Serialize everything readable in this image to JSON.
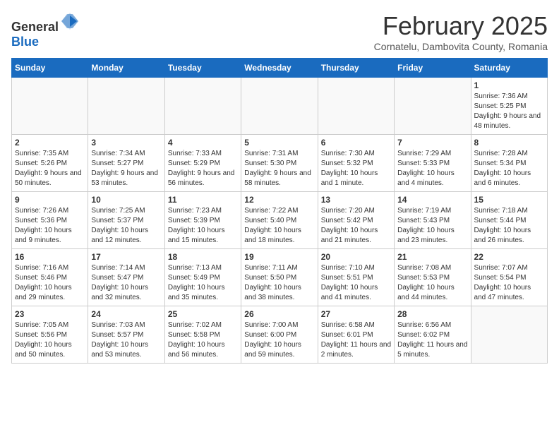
{
  "header": {
    "logo_general": "General",
    "logo_blue": "Blue",
    "month": "February 2025",
    "location": "Cornatelu, Dambovita County, Romania"
  },
  "weekdays": [
    "Sunday",
    "Monday",
    "Tuesday",
    "Wednesday",
    "Thursday",
    "Friday",
    "Saturday"
  ],
  "weeks": [
    [
      {
        "day": "",
        "info": ""
      },
      {
        "day": "",
        "info": ""
      },
      {
        "day": "",
        "info": ""
      },
      {
        "day": "",
        "info": ""
      },
      {
        "day": "",
        "info": ""
      },
      {
        "day": "",
        "info": ""
      },
      {
        "day": "1",
        "info": "Sunrise: 7:36 AM\nSunset: 5:25 PM\nDaylight: 9 hours and 48 minutes."
      }
    ],
    [
      {
        "day": "2",
        "info": "Sunrise: 7:35 AM\nSunset: 5:26 PM\nDaylight: 9 hours and 50 minutes."
      },
      {
        "day": "3",
        "info": "Sunrise: 7:34 AM\nSunset: 5:27 PM\nDaylight: 9 hours and 53 minutes."
      },
      {
        "day": "4",
        "info": "Sunrise: 7:33 AM\nSunset: 5:29 PM\nDaylight: 9 hours and 56 minutes."
      },
      {
        "day": "5",
        "info": "Sunrise: 7:31 AM\nSunset: 5:30 PM\nDaylight: 9 hours and 58 minutes."
      },
      {
        "day": "6",
        "info": "Sunrise: 7:30 AM\nSunset: 5:32 PM\nDaylight: 10 hours and 1 minute."
      },
      {
        "day": "7",
        "info": "Sunrise: 7:29 AM\nSunset: 5:33 PM\nDaylight: 10 hours and 4 minutes."
      },
      {
        "day": "8",
        "info": "Sunrise: 7:28 AM\nSunset: 5:34 PM\nDaylight: 10 hours and 6 minutes."
      }
    ],
    [
      {
        "day": "9",
        "info": "Sunrise: 7:26 AM\nSunset: 5:36 PM\nDaylight: 10 hours and 9 minutes."
      },
      {
        "day": "10",
        "info": "Sunrise: 7:25 AM\nSunset: 5:37 PM\nDaylight: 10 hours and 12 minutes."
      },
      {
        "day": "11",
        "info": "Sunrise: 7:23 AM\nSunset: 5:39 PM\nDaylight: 10 hours and 15 minutes."
      },
      {
        "day": "12",
        "info": "Sunrise: 7:22 AM\nSunset: 5:40 PM\nDaylight: 10 hours and 18 minutes."
      },
      {
        "day": "13",
        "info": "Sunrise: 7:20 AM\nSunset: 5:42 PM\nDaylight: 10 hours and 21 minutes."
      },
      {
        "day": "14",
        "info": "Sunrise: 7:19 AM\nSunset: 5:43 PM\nDaylight: 10 hours and 23 minutes."
      },
      {
        "day": "15",
        "info": "Sunrise: 7:18 AM\nSunset: 5:44 PM\nDaylight: 10 hours and 26 minutes."
      }
    ],
    [
      {
        "day": "16",
        "info": "Sunrise: 7:16 AM\nSunset: 5:46 PM\nDaylight: 10 hours and 29 minutes."
      },
      {
        "day": "17",
        "info": "Sunrise: 7:14 AM\nSunset: 5:47 PM\nDaylight: 10 hours and 32 minutes."
      },
      {
        "day": "18",
        "info": "Sunrise: 7:13 AM\nSunset: 5:49 PM\nDaylight: 10 hours and 35 minutes."
      },
      {
        "day": "19",
        "info": "Sunrise: 7:11 AM\nSunset: 5:50 PM\nDaylight: 10 hours and 38 minutes."
      },
      {
        "day": "20",
        "info": "Sunrise: 7:10 AM\nSunset: 5:51 PM\nDaylight: 10 hours and 41 minutes."
      },
      {
        "day": "21",
        "info": "Sunrise: 7:08 AM\nSunset: 5:53 PM\nDaylight: 10 hours and 44 minutes."
      },
      {
        "day": "22",
        "info": "Sunrise: 7:07 AM\nSunset: 5:54 PM\nDaylight: 10 hours and 47 minutes."
      }
    ],
    [
      {
        "day": "23",
        "info": "Sunrise: 7:05 AM\nSunset: 5:56 PM\nDaylight: 10 hours and 50 minutes."
      },
      {
        "day": "24",
        "info": "Sunrise: 7:03 AM\nSunset: 5:57 PM\nDaylight: 10 hours and 53 minutes."
      },
      {
        "day": "25",
        "info": "Sunrise: 7:02 AM\nSunset: 5:58 PM\nDaylight: 10 hours and 56 minutes."
      },
      {
        "day": "26",
        "info": "Sunrise: 7:00 AM\nSunset: 6:00 PM\nDaylight: 10 hours and 59 minutes."
      },
      {
        "day": "27",
        "info": "Sunrise: 6:58 AM\nSunset: 6:01 PM\nDaylight: 11 hours and 2 minutes."
      },
      {
        "day": "28",
        "info": "Sunrise: 6:56 AM\nSunset: 6:02 PM\nDaylight: 11 hours and 5 minutes."
      },
      {
        "day": "",
        "info": ""
      }
    ]
  ]
}
